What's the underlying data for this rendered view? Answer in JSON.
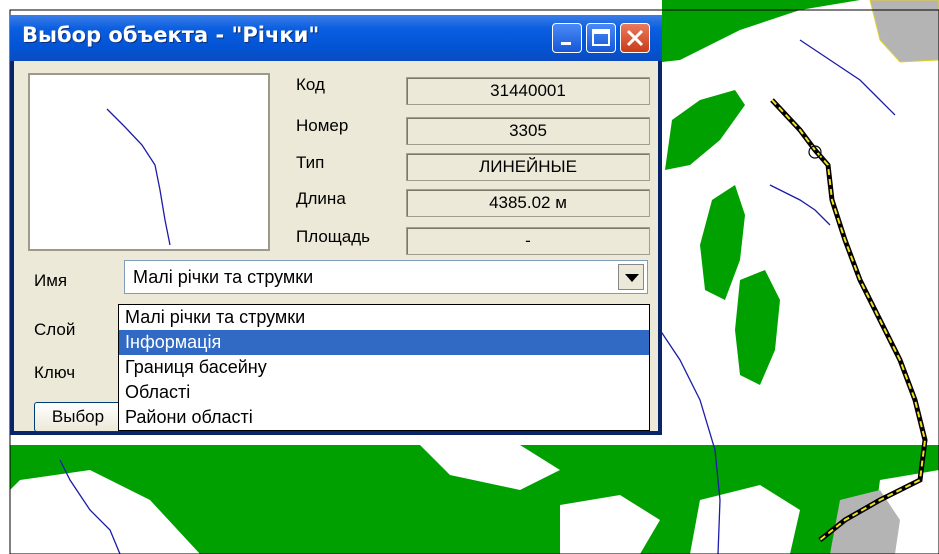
{
  "window": {
    "title": "Выбор объекта - \"Річки\""
  },
  "properties": {
    "code_label": "Код",
    "code_value": "31440001",
    "number_label": "Номер",
    "number_value": "3305",
    "type_label": "Тип",
    "type_value": "ЛИНЕЙНЫЕ",
    "length_label": "Длина",
    "length_value": "4385.02  м",
    "area_label": "Площадь",
    "area_value": "-"
  },
  "form": {
    "name_label": "Имя",
    "layer_label": "Слой",
    "key_label": "Ключ",
    "name_selected": "Малі річки та струмки",
    "select_button": "Выбор"
  },
  "dropdown": {
    "options": [
      "Малі річки та струмки",
      "Інформація",
      "Границя басейну",
      "Області",
      "Райони області"
    ],
    "highlighted_index": 1
  },
  "colors": {
    "map_green": "#00a000",
    "map_gray": "#b4b4b4",
    "river_blue": "#1c1ca8",
    "boundary_yellow": "#f0e020",
    "selection_blue": "#316ac5"
  }
}
